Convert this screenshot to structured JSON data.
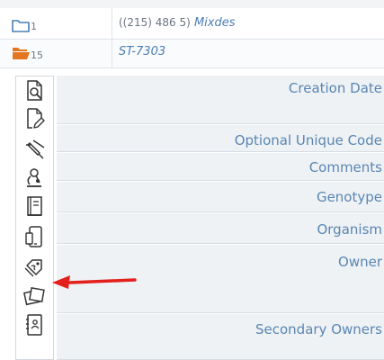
{
  "rows": [
    {
      "count": "1",
      "text_phone": "((215) 486 5)",
      "text_name": "Mixdes"
    },
    {
      "count": "15",
      "text_code": "ST-7303"
    }
  ],
  "toolbar": {
    "tools": [
      "document-search-icon",
      "document-edit-icon",
      "syringe-icon",
      "microscope-icon",
      "notebook-icon",
      "phone-tablet-icon",
      "price-tag-icon",
      "photos-icon",
      "address-book-icon"
    ]
  },
  "form": {
    "fields": [
      {
        "label": "Creation Date"
      },
      {
        "label": "Optional Unique Code"
      },
      {
        "label": "Comments"
      },
      {
        "label": "Genotype"
      },
      {
        "label": "Organism"
      },
      {
        "label": "Owner"
      },
      {
        "label": "Secondary Owners"
      }
    ]
  },
  "colors": {
    "accent": "#4b7fb4",
    "folder_orange": "#e4761f",
    "arrow_red": "#e3201b",
    "field_bg": "#eef2f5"
  }
}
